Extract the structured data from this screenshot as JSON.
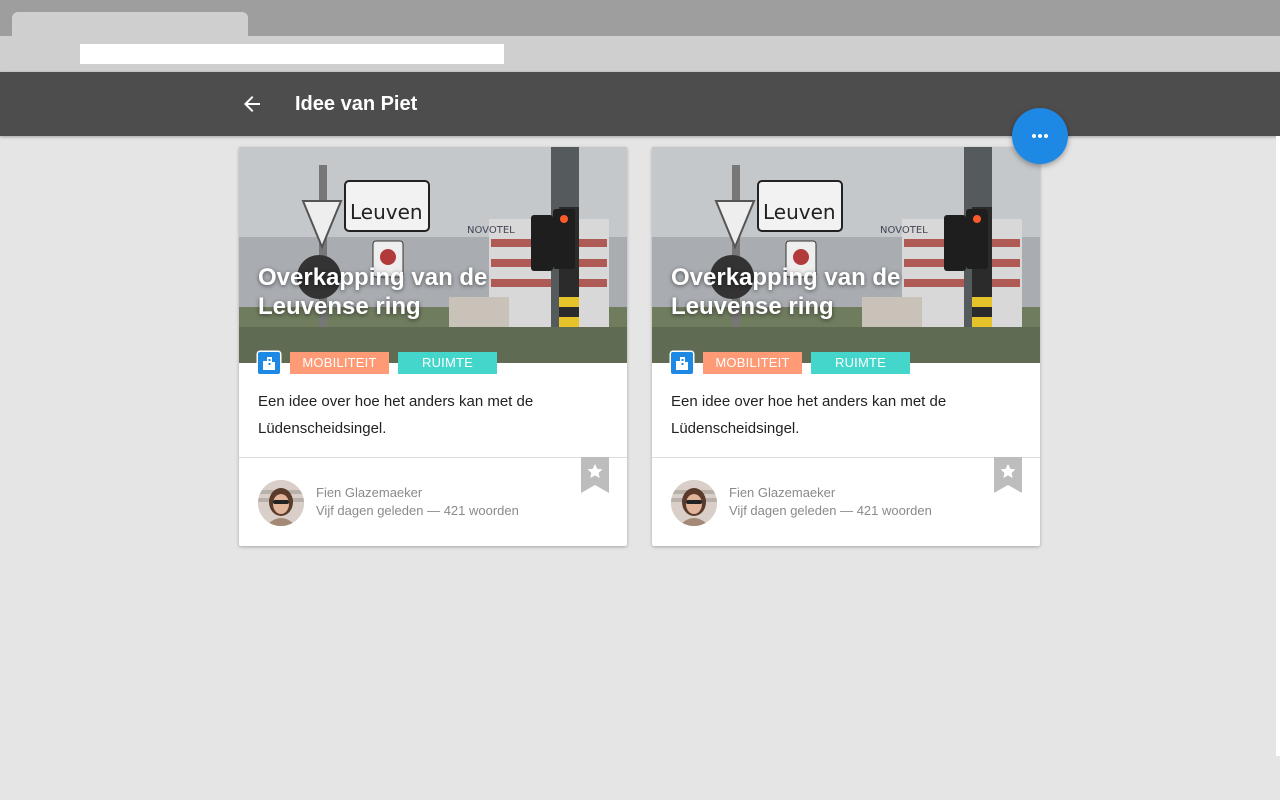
{
  "app": {
    "title": "Idee van Piet",
    "accent_color": "#1e88e5",
    "appbar_color": "#4d4d4d"
  },
  "header": {
    "back_icon": "arrow-back-icon",
    "more_icon": "more-horizontal-icon"
  },
  "cards": [
    {
      "title": "Overkapping van de Leuvense ring",
      "category_icon": "city-buildings-icon",
      "tags": [
        {
          "label": "MOBILITEIT",
          "color": "#ff9a76"
        },
        {
          "label": "RUIMTE",
          "color": "#45d6cb"
        }
      ],
      "description": "Een idee over hoe het anders kan met de Lüdenscheidsingel.",
      "author": "Fien Glazemaeker",
      "meta": "Vijf dagen geleden — 421 woorden",
      "bookmark_icon": "star-bookmark-icon",
      "image": {
        "sign_text": "Leuven",
        "building_text": "NOVOTEL"
      }
    },
    {
      "title": "Overkapping van de Leuvense ring",
      "category_icon": "city-buildings-icon",
      "tags": [
        {
          "label": "MOBILITEIT",
          "color": "#ff9a76"
        },
        {
          "label": "RUIMTE",
          "color": "#45d6cb"
        }
      ],
      "description": "Een idee over hoe het anders kan met de Lüdenscheidsingel.",
      "author": "Fien Glazemaeker",
      "meta": "Vijf dagen geleden — 421 woorden",
      "bookmark_icon": "star-bookmark-icon",
      "image": {
        "sign_text": "Leuven",
        "building_text": "NOVOTEL"
      }
    }
  ]
}
